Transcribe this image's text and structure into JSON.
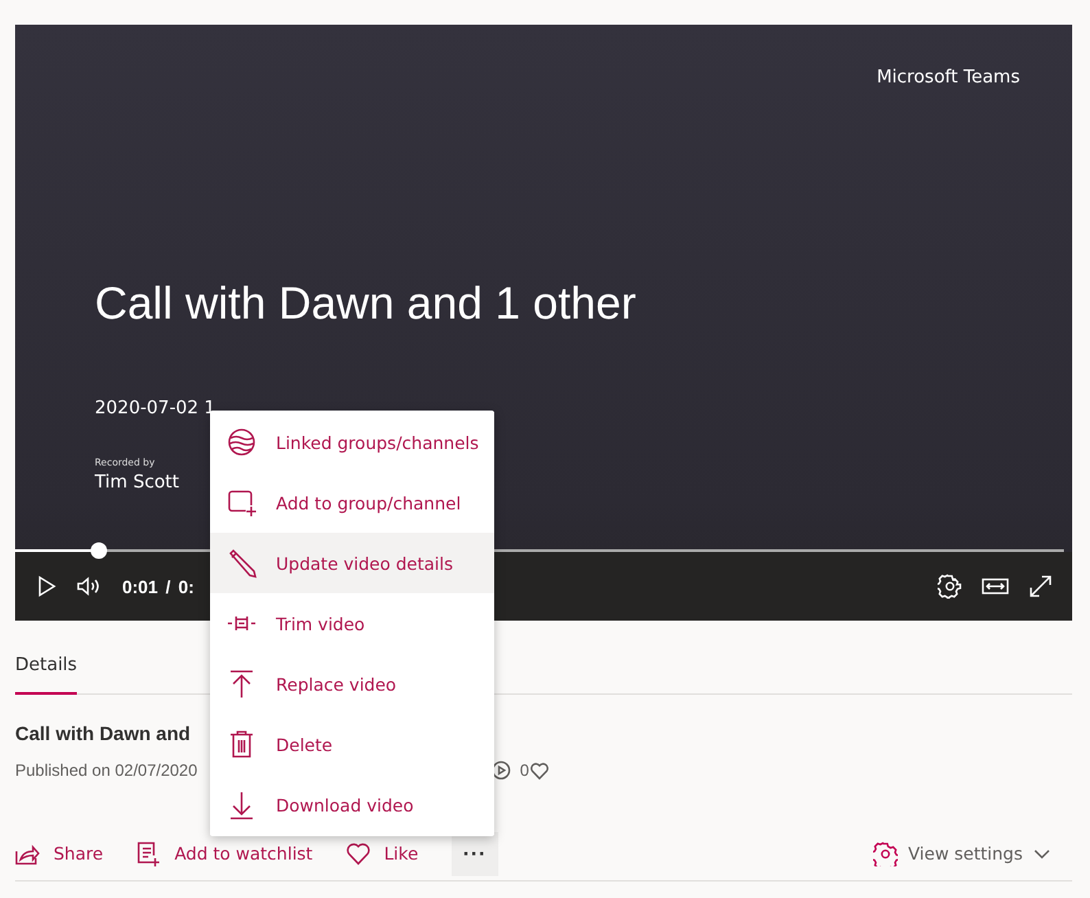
{
  "video": {
    "brand": "Microsoft Teams",
    "title": "Call with Dawn and 1 other",
    "date": "2020-07-02 1",
    "recorded_by_label": "Recorded by",
    "recorded_by": "Tim Scott",
    "player": {
      "level": 0.08,
      "time": "0:01 / 0:"
    }
  },
  "menu": [
    {
      "kind": "linked",
      "label": "Linked groups/channels",
      "selected": false
    },
    {
      "kind": "add",
      "label": "Add to group/channel",
      "selected": false
    },
    {
      "kind": "edit",
      "label": "Update video details",
      "selected": true
    },
    {
      "kind": "trim",
      "label": "Trim video",
      "selected": false
    },
    {
      "kind": "replace",
      "label": "Replace video",
      "selected": false
    },
    {
      "kind": "delete",
      "label": "Delete",
      "selected": false
    },
    {
      "kind": "download",
      "label": "Download video",
      "selected": false
    }
  ],
  "tabs": [
    {
      "label": "Details",
      "selected": true
    }
  ],
  "details": {
    "title": "Call with Dawn and",
    "published": "Published on 02/07/2020",
    "likes": "0"
  },
  "actions": [
    {
      "kind": "share",
      "label": "Share"
    },
    {
      "kind": "watchlist",
      "label": "Add to watchlist"
    },
    {
      "kind": "like",
      "label": "Like"
    },
    {
      "kind": "more",
      "label": "···"
    }
  ],
  "view_settings": "View settings"
}
